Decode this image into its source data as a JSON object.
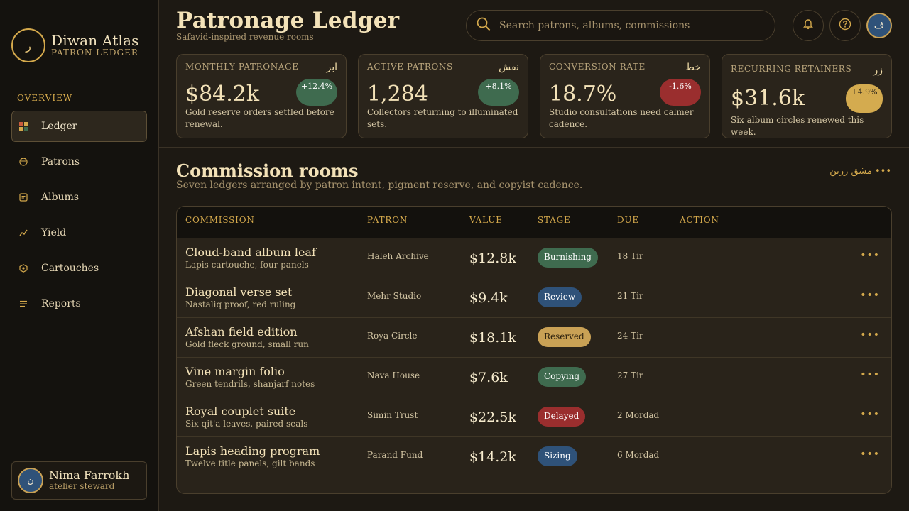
{
  "brand": {
    "mark": "ر",
    "name": "Diwan Atlas",
    "sub": "PATRON LEDGER"
  },
  "nav": {
    "heading": "OVERVIEW",
    "items": [
      {
        "label": "Ledger",
        "icon": "ledger-grid-icon"
      },
      {
        "label": "Patrons",
        "icon": "patrons-icon"
      },
      {
        "label": "Albums",
        "icon": "album-icon"
      },
      {
        "label": "Yield",
        "icon": "trend-icon"
      },
      {
        "label": "Cartouches",
        "icon": "cartouche-icon"
      },
      {
        "label": "Reports",
        "icon": "reports-icon"
      }
    ]
  },
  "user": {
    "initial": "ن",
    "name": "Nima Farrokh",
    "role": "atelier steward"
  },
  "header": {
    "title": "Patronage Ledger",
    "subtitle": "Safavid-inspired revenue rooms",
    "search_placeholder": "Search patrons, albums, commissions",
    "avatar_initial": "ف"
  },
  "stats": [
    {
      "label": "MONTHLY PATRONAGE",
      "glyph": "ابر",
      "value": "$84.2k",
      "change": "+12.4%",
      "badge_color": "#3f6b4f",
      "desc": "Gold reserve orders settled before renewal."
    },
    {
      "label": "ACTIVE PATRONS",
      "glyph": "نقش",
      "value": "1,284",
      "change": "+8.1%",
      "badge_color": "#3f6b4f",
      "desc": "Collectors returning to illuminated sets."
    },
    {
      "label": "CONVERSION RATE",
      "glyph": "خط",
      "value": "18.7%",
      "change": "-1.6%",
      "badge_color": "#9a2e2e",
      "desc": "Studio consultations need calmer cadence."
    },
    {
      "label": "RECURRING RETAINERS",
      "glyph": "زر",
      "value": "$31.6k",
      "change": "+4.9%",
      "badge_color": "#d4ab4f",
      "desc": "Six album circles renewed this week."
    }
  ],
  "section": {
    "title": "Commission rooms",
    "subtitle": "Seven ledgers arranged by patron intent, pigment reserve, and copyist cadence.",
    "more": "مشق زرین •••"
  },
  "table": {
    "columns": [
      "COMMISSION",
      "PATRON",
      "VALUE",
      "STAGE",
      "DUE",
      "ACTION"
    ],
    "rows": [
      {
        "title": "Cloud-band album leaf",
        "sub": "Lapis cartouche, four panels",
        "patron": "Haleh Archive",
        "value": "$12.8k",
        "stage": "Burnishing",
        "stage_color": "#3f6b4f",
        "due": "18 Tir",
        "action": "•••"
      },
      {
        "title": "Diagonal verse set",
        "sub": "Nastaliq proof, red ruling",
        "patron": "Mehr Studio",
        "value": "$9.4k",
        "stage": "Review",
        "stage_color": "#2f5279",
        "due": "21 Tir",
        "action": "•••"
      },
      {
        "title": "Afshan field edition",
        "sub": "Gold fleck ground, small run",
        "patron": "Roya Circle",
        "value": "$18.1k",
        "stage": "Reserved",
        "stage_color": "#c9a155",
        "due": "24 Tir",
        "action": "•••"
      },
      {
        "title": "Vine margin folio",
        "sub": "Green tendrils, shanjarf notes",
        "patron": "Nava House",
        "value": "$7.6k",
        "stage": "Copying",
        "stage_color": "#3f6b4f",
        "due": "27 Tir",
        "action": "•••"
      },
      {
        "title": "Royal couplet suite",
        "sub": "Six qit'a leaves, paired seals",
        "patron": "Simin Trust",
        "value": "$22.5k",
        "stage": "Delayed",
        "stage_color": "#9a2e2e",
        "due": "2 Mordad",
        "action": "•••"
      },
      {
        "title": "Lapis heading program",
        "sub": "Twelve title panels, gilt bands",
        "patron": "Parand Fund",
        "value": "$14.2k",
        "stage": "Sizing",
        "stage_color": "#2f5279",
        "due": "6 Mordad",
        "action": "•••"
      }
    ]
  }
}
